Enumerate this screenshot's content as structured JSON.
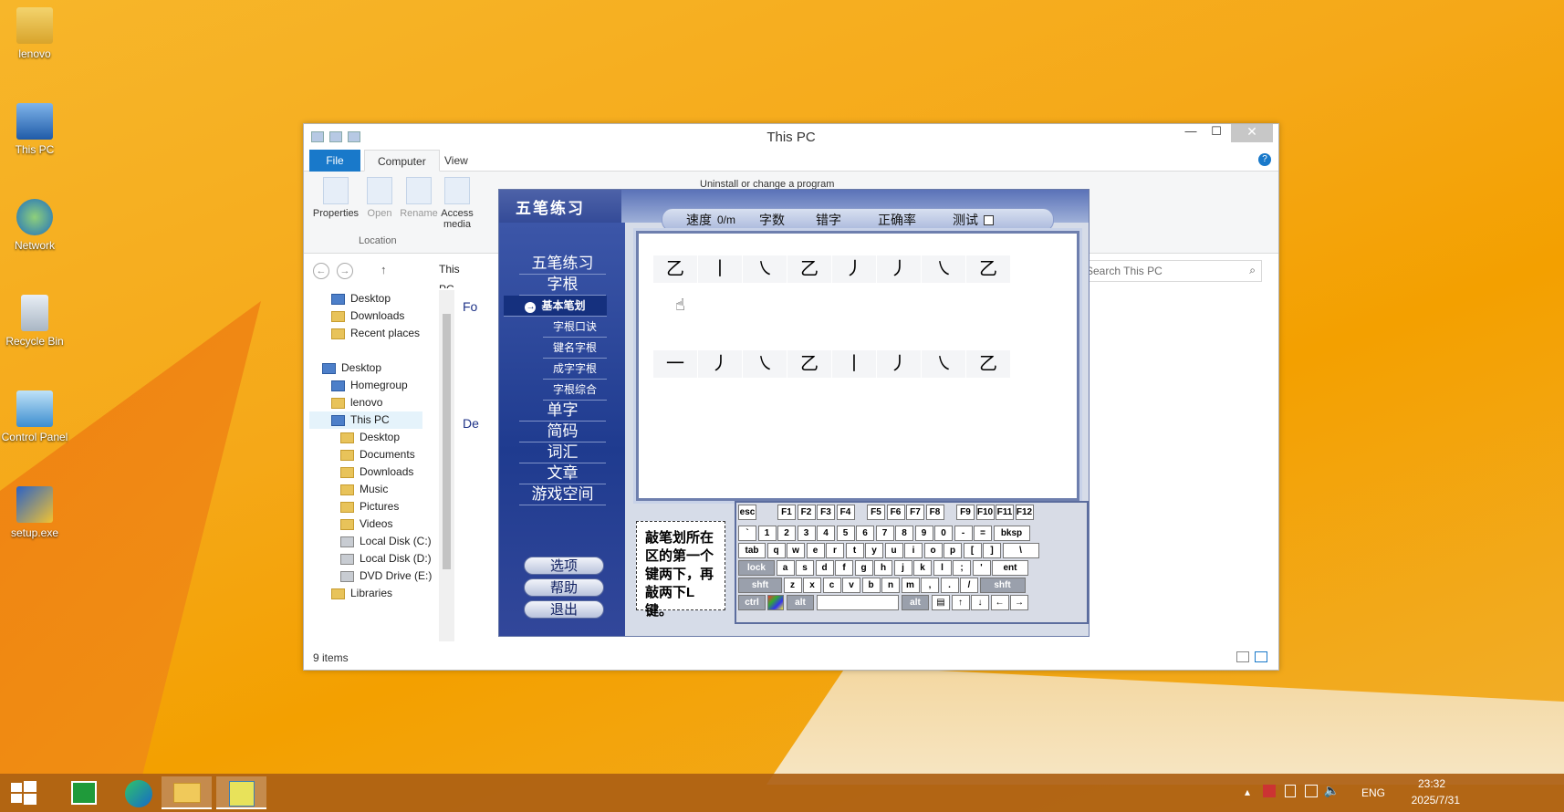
{
  "desktop": {
    "icons": [
      {
        "label": "lenovo",
        "icon": "user-folder-icon"
      },
      {
        "label": "This PC",
        "icon": "computer-icon"
      },
      {
        "label": "Network",
        "icon": "network-globe-icon"
      },
      {
        "label": "Recycle Bin",
        "icon": "recycle-bin-icon"
      },
      {
        "label": "Control Panel",
        "icon": "control-panel-icon"
      },
      {
        "label": "setup.exe",
        "icon": "installer-icon"
      }
    ]
  },
  "explorer": {
    "title": "This PC",
    "tabs": {
      "file": "File",
      "computer": "Computer",
      "view": "View"
    },
    "ribbon": {
      "properties": "Properties",
      "open": "Open",
      "rename": "Rename",
      "access_media": "Access media",
      "uninstall": "Uninstall or change a program",
      "group": "Location"
    },
    "address": "This PC",
    "search_placeholder": "Search This PC",
    "nav": {
      "desktop1": "Desktop",
      "downloads1": "Downloads",
      "recent": "Recent places",
      "desktop2": "Desktop",
      "homegroup": "Homegroup",
      "lenovo": "lenovo",
      "thispc": "This PC",
      "desktop3": "Desktop",
      "documents": "Documents",
      "downloads2": "Downloads",
      "music": "Music",
      "pictures": "Pictures",
      "videos": "Videos",
      "diskc": "Local Disk (C:)",
      "diskd": "Local Disk (D:)",
      "dvd": "DVD Drive (E:)",
      "libraries": "Libraries"
    },
    "content": {
      "folders_header": "Fo",
      "devices_header": "De"
    },
    "status": "9 items"
  },
  "wubi": {
    "title": "五笔练习",
    "stats": {
      "speed": "速度",
      "speed_val": "0/m",
      "chars": "字数",
      "errors": "错字",
      "accuracy": "正确率",
      "test": "测试"
    },
    "menu": {
      "m1": "五笔练习",
      "m2": "字根",
      "s1": "基本笔划",
      "s2": "字根口诀",
      "s3": "键名字根",
      "s4": "成字字根",
      "s5": "字根综合",
      "m3": "单字",
      "m4": "简码",
      "m5": "词汇",
      "m6": "文章",
      "m7": "游戏空间"
    },
    "buttons": {
      "options": "选项",
      "help": "帮助",
      "exit": "退出"
    },
    "row1": [
      "乙",
      "丨",
      "㇏",
      "乙",
      "丿",
      "丿",
      "㇏",
      "乙"
    ],
    "row2": [
      "一",
      "丿",
      "㇏",
      "乙",
      "丨",
      "丿",
      "㇏",
      "乙"
    ],
    "hint": "敲笔划所在区的第一个键两下，再敲两下L键。",
    "keys": {
      "r0": [
        "esc",
        "F1",
        "F2",
        "F3",
        "F4",
        "F5",
        "F6",
        "F7",
        "F8",
        "F9",
        "F10",
        "F11",
        "F12"
      ],
      "r1": [
        "`",
        "1",
        "2",
        "3",
        "4",
        "5",
        "6",
        "7",
        "8",
        "9",
        "0",
        "-",
        "=",
        "bksp"
      ],
      "r2": [
        "tab",
        "q",
        "w",
        "e",
        "r",
        "t",
        "y",
        "u",
        "i",
        "o",
        "p",
        "[",
        "]",
        "\\"
      ],
      "r3": [
        "lock",
        "a",
        "s",
        "d",
        "f",
        "g",
        "h",
        "j",
        "k",
        "l",
        ";",
        "'",
        "ent"
      ],
      "r4": [
        "shft",
        "z",
        "x",
        "c",
        "v",
        "b",
        "n",
        "m",
        ",",
        ".",
        "/",
        "shft"
      ],
      "r5": [
        "ctrl",
        "alt",
        "alt",
        "▤",
        "↑",
        "↓",
        "←",
        "→"
      ]
    }
  },
  "taskbar": {
    "lang": "ENG",
    "time": "23:32",
    "date": "2025/7/31"
  }
}
